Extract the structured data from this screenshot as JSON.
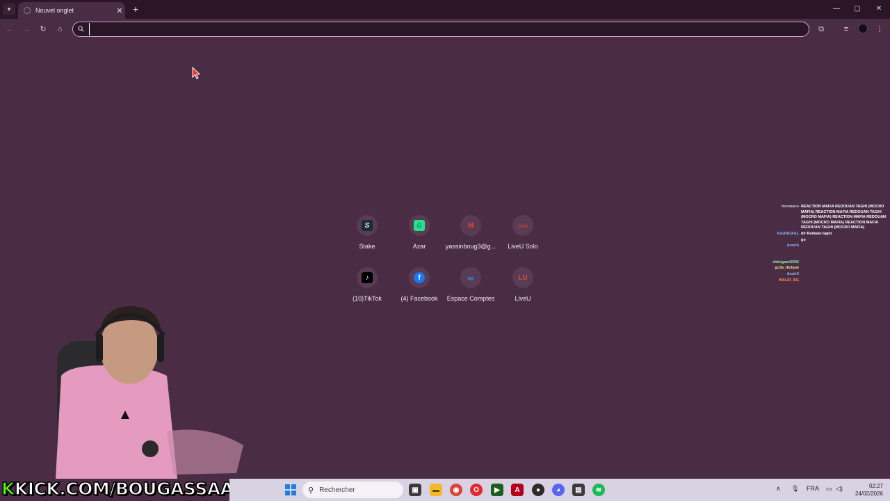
{
  "colors": {
    "accent": "#d3a7c7",
    "background": "#4a2d44",
    "kick_green": "#53fc18"
  },
  "browser": {
    "tab": {
      "title": "Nouvel onglet",
      "close": "✕"
    },
    "newtab": "+",
    "window": {
      "minimize": "—",
      "maximize": "▢",
      "close": "✕"
    },
    "nav": {
      "back": "←",
      "forward": "→",
      "reload": "↻",
      "home": "⌂"
    },
    "omnibox": {
      "value": "",
      "placeholder": ""
    },
    "tools": {
      "extensions": "⧉",
      "media": "≡",
      "menu": "⋮"
    }
  },
  "shortcuts": [
    {
      "label": "Stake",
      "icon": "stake-icon",
      "glyph": "S",
      "color": "#1a2c38"
    },
    {
      "label": "Azar",
      "icon": "azar-icon",
      "glyph": "☺",
      "color": "#27e08f"
    },
    {
      "label": "yassinboug3@g...",
      "icon": "gmail-icon",
      "glyph": "M",
      "color": "#5a3b54"
    },
    {
      "label": "LiveU Solo",
      "icon": "liveu-solo-icon",
      "glyph": "Solo",
      "color": "#5a3b54"
    },
    {
      "label": "(10)TikTok",
      "icon": "tiktok-icon",
      "glyph": "♪",
      "color": "#000000"
    },
    {
      "label": "(4) Facebook",
      "icon": "facebook-icon",
      "glyph": "f",
      "color": "#1877f2"
    },
    {
      "label": "Espace Comptes",
      "icon": "meta-icon",
      "glyph": "∞",
      "color": "#5a3b54"
    },
    {
      "label": "LiveU",
      "icon": "liveu-icon",
      "glyph": "LU",
      "color": "#5a3b54"
    }
  ],
  "chat": [
    {
      "user": "hiromann",
      "color": "#cfcfcf",
      "msg": "REACTION MAFIA REDOUAN TAGHI (MOCRO MAFIA) REACTION MAFIA REDOUAN TAGHI (MOCRO MAFIA) REACTION MAFIA REDOUAN TAGHI (MOCRO MAFIA) REACTION MAFIA REDOUAN TAGHI (MOCRO MAFIA)"
    },
    {
      "user": "KAARDAAL",
      "color": "#8fb7ff",
      "msg": "dir Redwan taghi"
    },
    {
      "user": "",
      "color": "#a78bfa",
      "msg": "go"
    },
    {
      "user": "Anoir6",
      "color": "#8fb7ff",
      "msg": ""
    },
    {
      "user": "",
      "color": "#e11d48",
      "msg": ""
    },
    {
      "user": "shinigami2002",
      "color": "#86efac",
      "msg": ""
    },
    {
      "user": "gc3a_lliclque",
      "color": "#fde68a",
      "msg": ""
    },
    {
      "user": "Anoir6",
      "color": "#8fb7ff",
      "msg": ""
    },
    {
      "user": "WALID_BG",
      "color": "#fb923c",
      "msg": ""
    }
  ],
  "overlay": {
    "kick_k": "K",
    "kick_rest": "KICK.COM/BOUGASSAA"
  },
  "taskbar": {
    "search_placeholder": "Rechercher",
    "lang": "FRA",
    "time": "02:27",
    "date": "24/02/2026",
    "apps": [
      {
        "name": "taskview-icon",
        "glyph": "▣",
        "color": "#333333"
      },
      {
        "name": "explorer-icon",
        "glyph": "▬",
        "color": "#f2b92d"
      },
      {
        "name": "chrome-icon",
        "glyph": "◉",
        "color": "#db4437"
      },
      {
        "name": "opera-icon",
        "glyph": "O",
        "color": "#e3282f"
      },
      {
        "name": "terminal-icon",
        "glyph": "▶",
        "color": "#1b5e20"
      },
      {
        "name": "acrobat-icon",
        "glyph": "A",
        "color": "#b3001b"
      },
      {
        "name": "obs-icon",
        "glyph": "●",
        "color": "#2b2b2b"
      },
      {
        "name": "discord-icon",
        "glyph": "◕",
        "color": "#5865f2"
      },
      {
        "name": "store-icon",
        "glyph": "▤",
        "color": "#333333"
      },
      {
        "name": "spotify-icon",
        "glyph": "≋",
        "color": "#1db954"
      }
    ]
  }
}
